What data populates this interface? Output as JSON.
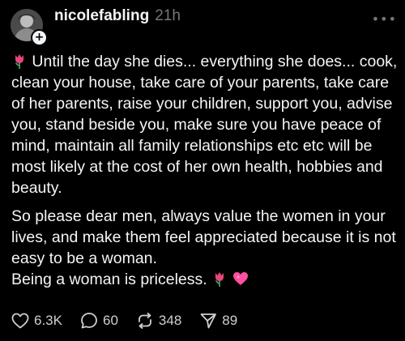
{
  "post": {
    "author": "nicolefabling",
    "time": "21h",
    "more_label": "•••",
    "follow_label": "+",
    "paragraphs": [
      "Until the day she dies... everything she does... cook, clean your house, take care of your parents, take care of her parents, raise your children, support you, advise you, stand beside you, make sure you have peace of mind, maintain all family relationships etc etc will be most likely at the cost of her own health, hobbies and beauty.",
      "So please dear men, always value the women in your lives, and make them feel appreciated because it is not easy to be a woman.",
      "Being a woman is priceless."
    ],
    "emojis": {
      "lead": "tulip-emoji",
      "trail": [
        "tulip-emoji",
        "sparkling-heart-emoji"
      ]
    }
  },
  "actions": {
    "likes": "6.3K",
    "replies": "60",
    "reposts": "348",
    "shares": "89"
  },
  "colors": {
    "background": "#000000",
    "text": "#f3f5f7",
    "muted": "#777777",
    "tulip": "#e8457a",
    "heart": "#ff4fa3"
  }
}
